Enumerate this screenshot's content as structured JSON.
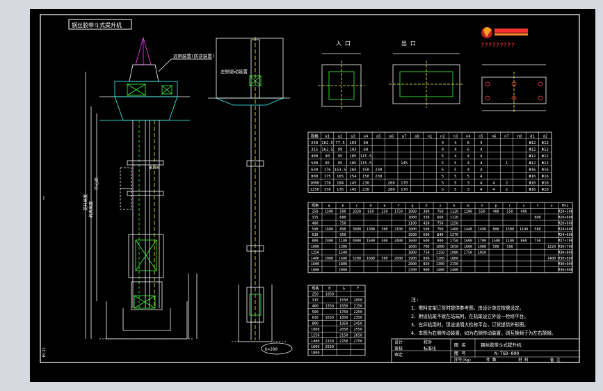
{
  "title": "钢丝胶带斗式提升机",
  "logo_caption": "?????????",
  "inlet_label": "入 口",
  "outlet_label": "出 口",
  "callouts": {
    "top_note": "远用装置(防逆装置)",
    "left_note": "左侧驱动装置",
    "size_label": "b×200",
    "tag_a": "H",
    "tag_b": "Φ100"
  },
  "table1": {
    "headers": [
      "规格",
      "a1",
      "a2",
      "a3",
      "a4",
      "a5",
      "a6",
      "a7",
      "a8",
      "n1",
      "n2",
      "n3",
      "n4",
      "n5",
      "n6",
      "n7",
      "n8",
      "d1",
      "d2"
    ],
    "rows": [
      [
        "250",
        "162.5",
        "77.5",
        "103",
        "60",
        "",
        "",
        "",
        "",
        "",
        "4",
        "4",
        "6",
        "4",
        "",
        "",
        "",
        "Φ12",
        "Φ12"
      ],
      [
        "315",
        "162.5",
        "99",
        "103",
        "60",
        "",
        "",
        "",
        "",
        "",
        "4",
        "4",
        "6",
        "4",
        "",
        "",
        "",
        "Φ12",
        "Φ12"
      ],
      [
        "400",
        "90",
        "95",
        "105",
        "115.5",
        "",
        "",
        "",
        "",
        "",
        "5",
        "4",
        "4",
        "4",
        "",
        "",
        "",
        "Φ12",
        "Φ12"
      ],
      [
        "500",
        "95",
        "95",
        "105",
        "115.5",
        "",
        "",
        "145",
        "",
        "",
        "5",
        "5",
        "4",
        "4",
        "",
        "1",
        "",
        "Φ12",
        "Φ12"
      ],
      [
        "630",
        "176",
        "153.5",
        "265",
        "150",
        "230",
        "",
        "",
        "",
        "",
        "5",
        "5",
        "4",
        "4",
        "",
        "",
        "",
        "Φ16",
        "Φ16"
      ],
      [
        "800",
        "175",
        "165",
        "254",
        "150",
        "230",
        "",
        "",
        "",
        "",
        "5",
        "5",
        "5",
        "4",
        "",
        "",
        "",
        "Φ16",
        "Φ16"
      ],
      [
        "1000",
        "178",
        "184",
        "145",
        "230",
        "",
        "260",
        "170",
        "",
        "",
        "5",
        "5",
        "3",
        "4",
        "4",
        "2",
        "",
        "Φ16",
        "Φ16"
      ],
      [
        "1250",
        "178",
        "176",
        "145",
        "230",
        "",
        "260",
        "170",
        "",
        "",
        "5",
        "5",
        "3",
        "4",
        "4",
        "2",
        "",
        "Φ16",
        "Φ16"
      ]
    ]
  },
  "table2": {
    "headers": [
      "规格",
      "a",
      "b",
      "c",
      "d",
      "e",
      "f",
      "g",
      "h",
      "i",
      "k",
      "m",
      "n",
      "p",
      "r",
      "s",
      "t",
      "u",
      "M×L"
    ],
    "rows": [
      [
        "250",
        "1500",
        "500",
        "3320",
        "950",
        "250",
        "1750",
        "1080",
        "380",
        "760",
        "1120",
        "1280",
        "550",
        "400",
        "550",
        "400",
        "",
        "",
        "M20×500"
      ],
      [
        "315",
        "",
        "680",
        "",
        "",
        "",
        "",
        "1000",
        "330",
        "660",
        "1120",
        "",
        "",
        "",
        "",
        "",
        "800",
        "",
        "M20×600"
      ],
      [
        "400",
        "",
        "750",
        "",
        "",
        "",
        "",
        "1100",
        "430",
        "750",
        "1250",
        "",
        "",
        "",
        "",
        "",
        "",
        "",
        "M20×600"
      ],
      [
        "500",
        "1600",
        "890",
        "3800",
        "1300",
        "300",
        "2100",
        "1000",
        "500",
        "760",
        "1460",
        "1440",
        "1490",
        "800",
        "1500",
        "1190",
        "580",
        "",
        "M24×600"
      ],
      [
        "630",
        "",
        "950",
        "",
        "",
        "",
        "",
        "1500",
        "500",
        "840",
        "1370",
        "",
        "",
        "",
        "",
        "",
        "",
        "",
        "M24×600"
      ],
      [
        "800",
        "2400",
        "1100",
        "4000",
        "1500",
        "400",
        "2400",
        "1600",
        "600",
        "900",
        "1750",
        "1680",
        "1700",
        "1500",
        "1100",
        "860",
        "750",
        "",
        "M27×700"
      ],
      [
        "1000",
        "",
        "1300",
        "",
        "",
        "",
        "",
        "1600",
        "700",
        "1000",
        "1650",
        "1600",
        "1900",
        "500",
        "500",
        "",
        "",
        "1220",
        "M30×700"
      ],
      [
        "1250",
        "",
        "1500",
        "",
        "",
        "",
        "",
        "1800",
        "750",
        "1150",
        "1980",
        "1750",
        "1050",
        "",
        "",
        "",
        "",
        "",
        "M30×800"
      ],
      [
        "1400",
        "2000",
        "1600",
        "5200",
        "1600",
        "500",
        "2800",
        "1900",
        "800",
        "1200",
        "1800",
        "",
        "",
        "",
        "",
        "",
        "",
        "1400",
        "M30×800"
      ],
      [
        "1600",
        "",
        "1800",
        "",
        "",
        "",
        "",
        "2000",
        "850",
        "1300",
        "2150",
        "",
        "",
        "",
        "",
        "",
        "",
        "",
        "M30×900"
      ],
      [
        "1800",
        "",
        "2000",
        "",
        "",
        "",
        "",
        "2200",
        "900",
        "1400",
        "2400",
        "",
        "",
        "",
        "",
        "",
        "",
        "",
        "M30×900"
      ]
    ]
  },
  "table3": {
    "headers": [
      "规格",
      "B",
      "G",
      "F"
    ],
    "rows": [
      [
        "250",
        "1050",
        "",
        ""
      ],
      [
        "315",
        "",
        "1550",
        "2050"
      ],
      [
        "400",
        "1350",
        "1650",
        "2150"
      ],
      [
        "500",
        "",
        "1750",
        "2250"
      ],
      [
        "630",
        "1650",
        "1850",
        "2350"
      ],
      [
        "800",
        "",
        "1950",
        "2450"
      ],
      [
        "1000",
        "",
        "2050",
        "2550"
      ],
      [
        "1250",
        "",
        "2150",
        "2650"
      ],
      [
        "1400",
        "2150",
        "2250",
        "2750"
      ],
      [
        "1600",
        "2550",
        "",
        ""
      ],
      [
        "1800",
        "",
        "",
        ""
      ]
    ]
  },
  "notes_title": "注:",
  "notes": [
    "1、需料支架订货时提供参考图，由设计单位按需设定。",
    "2、附设机尾不就在站端列，在机尾设立外设一检修平台。",
    "3、在异机用时，现设说明大检修平台，订货提供外形图。",
    "4、本图为右侧传动装置，如为右侧传动装置，则互换频于为左右颠倒。"
  ],
  "title_block": {
    "labels": [
      "设计",
      "校对",
      "审核",
      "标准化",
      "审定"
    ],
    "name_label": "图  名",
    "name_value": "钢丝胶带斗式提升机",
    "code_label": "图  号",
    "code_value": "N-TGD-000",
    "footer": [
      "序号(Kg)",
      "件  数",
      "材  料",
      "备  注"
    ]
  },
  "side_labels": {
    "left_a": "提升高度",
    "left_b": "机壳高度",
    "left_c": "中心距",
    "left_d": "H(2)"
  }
}
